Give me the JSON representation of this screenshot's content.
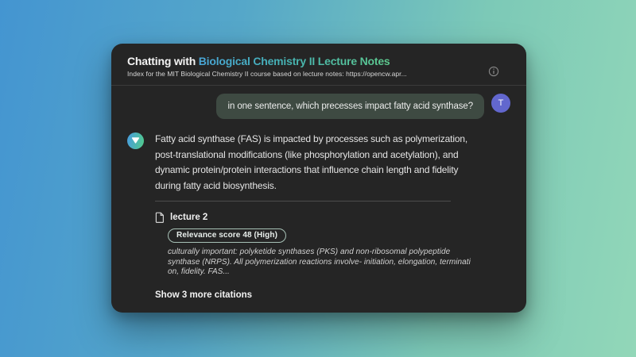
{
  "background": {
    "gradient_from": "#4495d1",
    "gradient_to": "#92d7b8"
  },
  "card": {
    "background": "#252525",
    "header": {
      "title_prefix": "Chatting with ",
      "title_highlight": "Biological Chemistry II Lecture Notes",
      "title_highlight_gradient": [
        "#49a6d8",
        "#5ecb8e"
      ],
      "subtitle": "Index for the MIT Biological Chemistry II course based on lecture notes: https://opencw.apr...",
      "info_icon": "info-circle-icon"
    },
    "user_message": {
      "text": "in one sentence, which precesses impact fatty acid synthase?",
      "bubble_color": "#3e4a42",
      "avatar_letter": "T",
      "avatar_color": "#6267ce"
    },
    "assistant_message": {
      "avatar_icon": "triangle-down-icon",
      "avatar_gradient": [
        "#49a0d8",
        "#50c792"
      ],
      "text": "Fatty acid synthase (FAS) is impacted by processes such as polymerization, post-translational modifications (like phosphorylation and acetylation), and dynamic protein/protein interactions that influence chain length and fidelity during fatty acid biosynthesis."
    },
    "citation": {
      "source_icon": "document-icon",
      "source_label": "lecture 2",
      "relevance_badge": "Relevance score 48 (High)",
      "excerpt": "culturally important: polyketide synthases (PKS) and non-ribosomal polypeptide synthase (NRPS). All polymerization reactions involve- initiation, elongation, terminati on, fidelity. FAS...",
      "show_more_label": "Show 3 more citations"
    }
  }
}
